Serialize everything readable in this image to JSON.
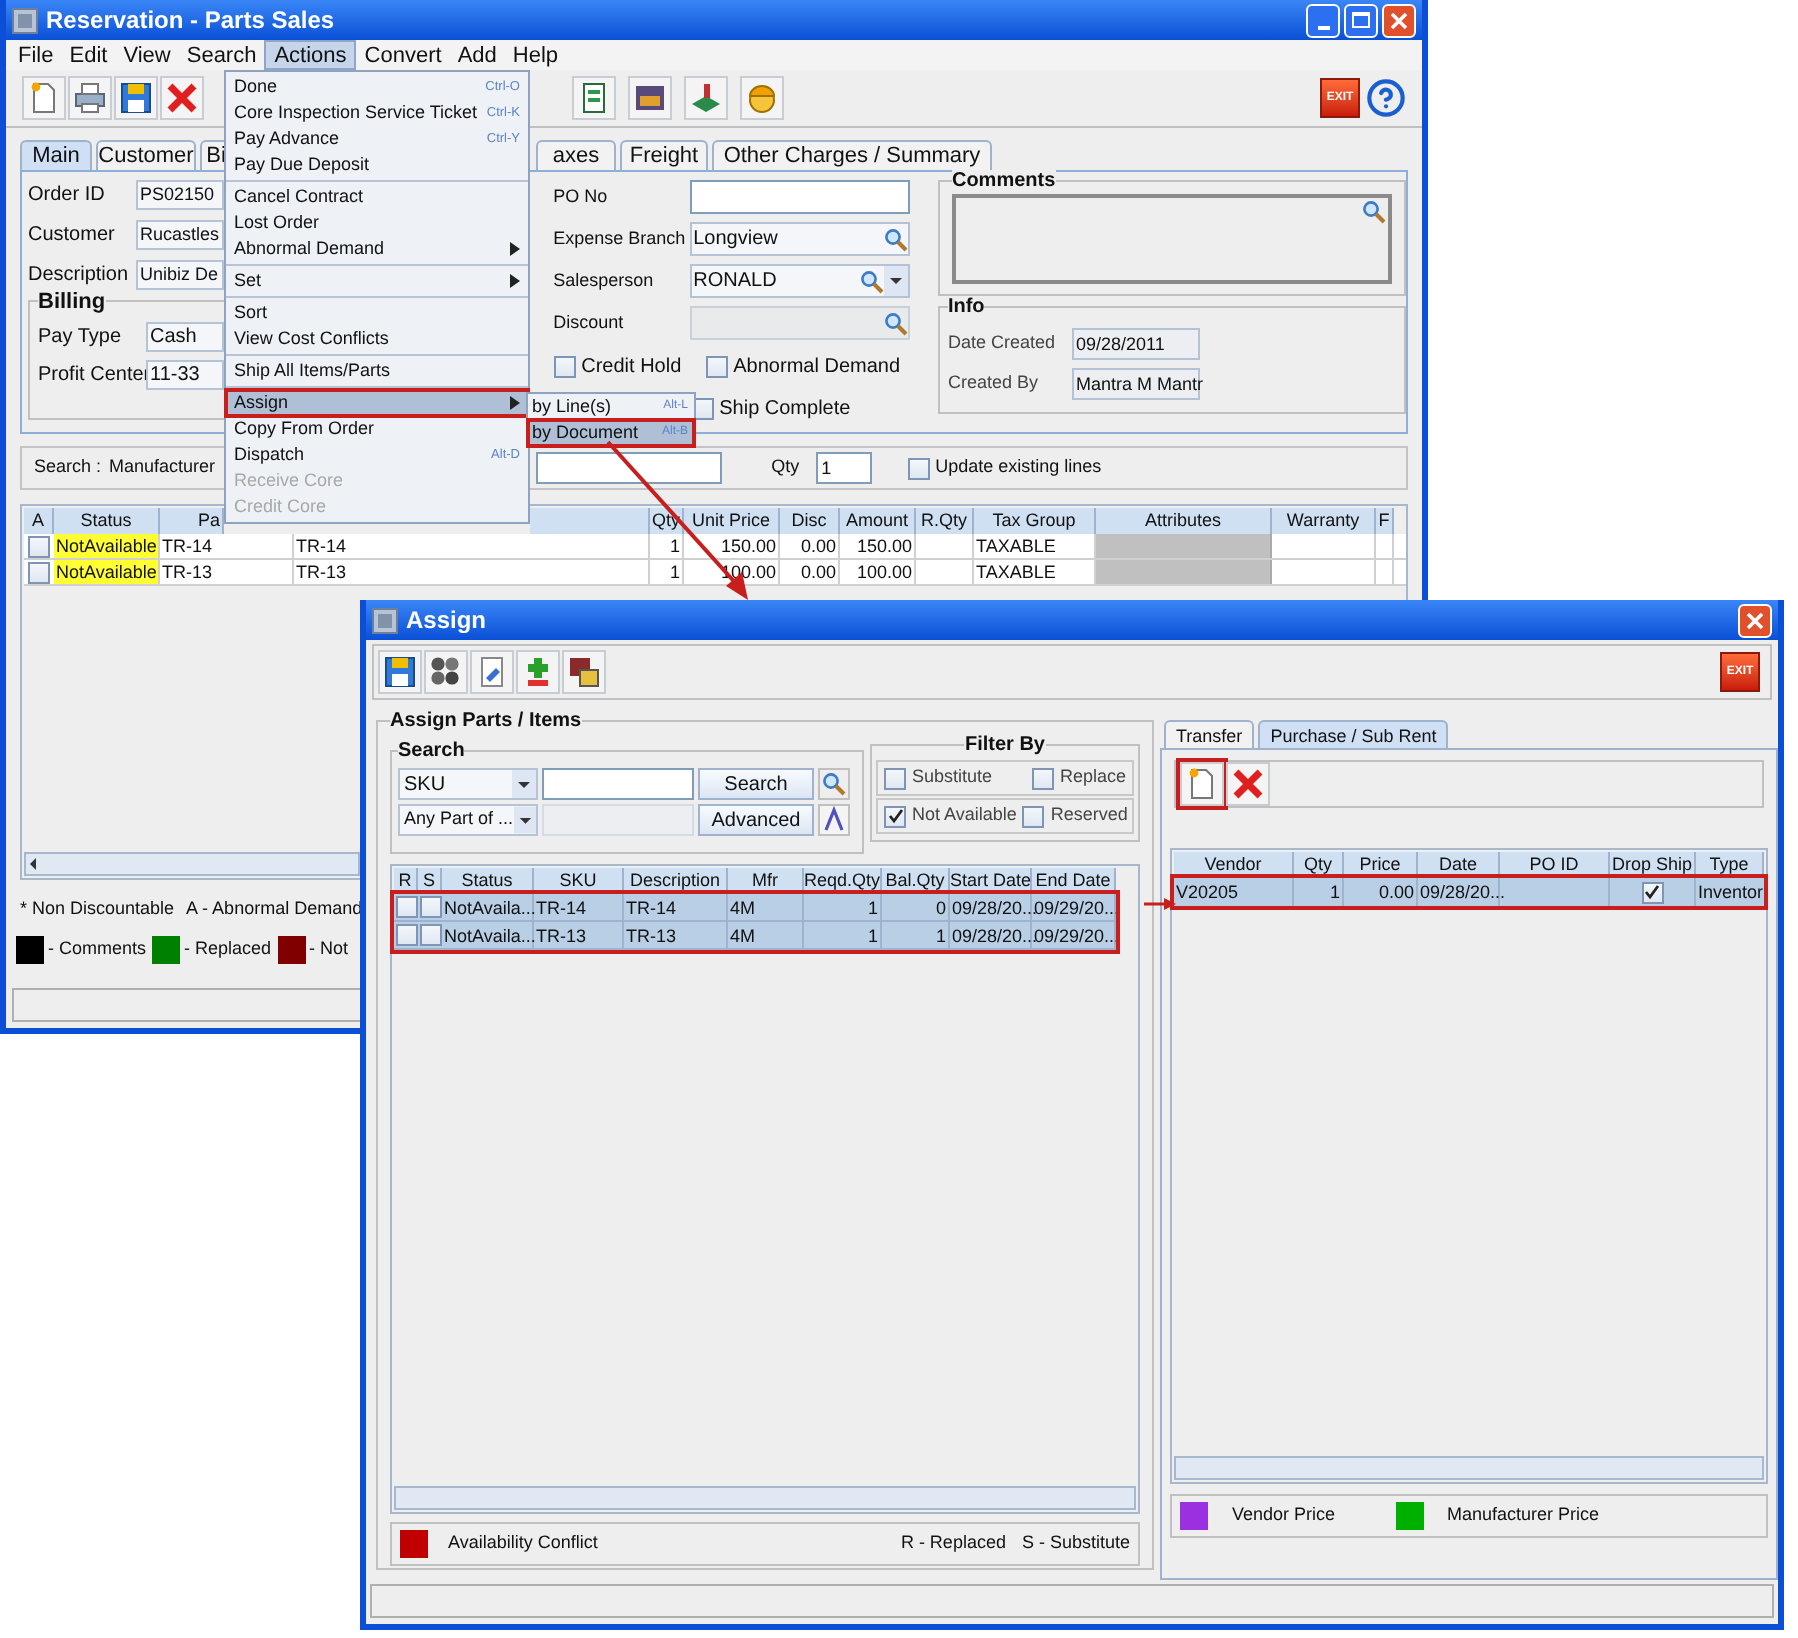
{
  "main_window": {
    "title": "Reservation - Parts Sales",
    "menu_bar": [
      {
        "label": "File",
        "selected": false
      },
      {
        "label": "Edit",
        "selected": false
      },
      {
        "label": "View",
        "selected": false
      },
      {
        "label": "Search",
        "selected": false
      },
      {
        "label": "Actions",
        "selected": true
      },
      {
        "label": "Convert",
        "selected": false
      },
      {
        "label": "Add",
        "selected": false
      },
      {
        "label": "Help",
        "selected": false
      }
    ],
    "exit_label": "EXIT",
    "tabs": [
      {
        "label": "Main",
        "selected": true
      },
      {
        "label": "Customer",
        "selected": false
      },
      {
        "label": "Bi",
        "selected": false
      },
      {
        "label": "axes",
        "selected": false
      },
      {
        "label": "Freight",
        "selected": false
      },
      {
        "label": "Other Charges / Summary",
        "selected": false
      }
    ],
    "left_fields": [
      {
        "label": "Order ID",
        "value": "PS02150"
      },
      {
        "label": "Customer",
        "value": "Rucastles"
      },
      {
        "label": "Description",
        "value": "Unibiz De"
      }
    ],
    "billing": {
      "title": "Billing",
      "fields": [
        {
          "label": "Pay Type",
          "value": "Cash"
        },
        {
          "label": "Profit Center",
          "value": "11-33"
        }
      ]
    },
    "middle_fields": [
      {
        "label": "PO No",
        "kind": "text"
      },
      {
        "label": "Expense Branch",
        "kind": "lookup",
        "value": "Longview"
      },
      {
        "label": "Salesperson",
        "kind": "lookup_dropdown",
        "value": "RONALD"
      },
      {
        "label": "Discount",
        "kind": "lookup_disabled"
      }
    ],
    "checkboxes": [
      {
        "label": "Credit Hold",
        "checked": false
      },
      {
        "label": "Abnormal Demand",
        "checked": false
      },
      {
        "label": "Ship Complete",
        "checked": false
      }
    ],
    "comments": {
      "title": "Comments"
    },
    "info": {
      "title": "Info",
      "fields": [
        {
          "label": "Date Created",
          "value": "09/28/2011"
        },
        {
          "label": "Created By",
          "value": "Mantra M Mantr"
        }
      ]
    },
    "search_bar": {
      "label": "Search :",
      "field_label": "Manufacturer",
      "qty_label": "Qty",
      "qty": "1",
      "update": {
        "label": "Update existing lines",
        "checked": false
      }
    },
    "table": {
      "columns": [
        "A",
        "Status",
        "Pa",
        "Qty",
        "Unit Price",
        "Disc",
        "Amount",
        "R.Qty",
        "Tax Group",
        "Attributes",
        "Warranty",
        "F"
      ],
      "rows": [
        {
          "checked": false,
          "available": false,
          "status": "NotAvailable",
          "part": "TR-14",
          "description": "TR-14",
          "qty": "1",
          "unit_price": "150.00",
          "disc": "0.00",
          "amount": "150.00",
          "tax_group": "TAXABLE"
        },
        {
          "checked": false,
          "available": false,
          "status": "NotAvailable",
          "part": "TR-13",
          "description": "TR-13",
          "qty": "1",
          "unit_price": "100.00",
          "disc": "0.00",
          "amount": "100.00",
          "tax_group": "TAXABLE"
        }
      ]
    },
    "legend": {
      "notes": [
        "* Non Discountable",
        "A - Abnormal Demand"
      ],
      "items": [
        {
          "label": "- Comments",
          "color": "#000000"
        },
        {
          "label": "- Replaced",
          "color": "#008000"
        },
        {
          "label": "- Not",
          "color": "#800000"
        }
      ]
    }
  },
  "actions_menu": [
    {
      "kind": "item",
      "label": "Done",
      "shortcut": "Ctrl-O"
    },
    {
      "kind": "item",
      "label": "Core Inspection Service Ticket",
      "shortcut": "Ctrl-K"
    },
    {
      "kind": "item",
      "label": "Pay Advance",
      "shortcut": "Ctrl-Y"
    },
    {
      "kind": "item",
      "label": "Pay Due Deposit"
    },
    {
      "kind": "separator"
    },
    {
      "kind": "item",
      "label": "Cancel Contract"
    },
    {
      "kind": "item",
      "label": "Lost Order"
    },
    {
      "kind": "submenu",
      "label": "Abnormal Demand",
      "selected": false
    },
    {
      "kind": "separator"
    },
    {
      "kind": "submenu",
      "label": "Set",
      "selected": false
    },
    {
      "kind": "separator"
    },
    {
      "kind": "item",
      "label": "Sort"
    },
    {
      "kind": "item",
      "label": "View Cost Conflicts"
    },
    {
      "kind": "separator"
    },
    {
      "kind": "item",
      "label": "Ship All Items/Parts"
    },
    {
      "kind": "separator"
    },
    {
      "kind": "submenu",
      "label": "Assign",
      "selected": true
    },
    {
      "kind": "item",
      "label": "Copy From Order"
    },
    {
      "kind": "item",
      "label": "Dispatch",
      "shortcut": "Alt-D"
    },
    {
      "kind": "disabled",
      "label": "Receive Core"
    },
    {
      "kind": "disabled",
      "label": "Credit Core"
    }
  ],
  "assign_submenu": [
    {
      "label": "by Line(s)",
      "shortcut": "Alt-L",
      "selected": false
    },
    {
      "label": "by Document",
      "shortcut": "Alt-B",
      "selected": true
    }
  ],
  "assign_dialog": {
    "title": "Assign",
    "exit_label": "EXIT",
    "panel_title": "Assign Parts / Items",
    "search": {
      "title": "Search",
      "field_type": "SKU",
      "match": "Any Part of ...",
      "search_button": "Search",
      "advanced_button": "Advanced"
    },
    "filter": {
      "title": "Filter By",
      "options": [
        {
          "label": "Substitute",
          "checked": false
        },
        {
          "label": "Replace",
          "checked": false
        },
        {
          "label": "Not Available",
          "checked": true
        },
        {
          "label": "Reserved",
          "checked": false
        }
      ]
    },
    "table": {
      "outlined": true,
      "columns": [
        "R",
        "S",
        "Status",
        "SKU",
        "Description",
        "Mfr",
        "Reqd.Qty",
        "Bal.Qty",
        "Start Date",
        "End Date"
      ],
      "rows": [
        {
          "replaced": false,
          "substitute": false,
          "selected": true,
          "status": "NotAvaila...",
          "sku": "TR-14",
          "description": "TR-14",
          "mfr": "4M",
          "reqd_qty": "1",
          "bal_qty": "0",
          "start_date": "09/28/20...",
          "end_date": "09/29/20..."
        },
        {
          "replaced": false,
          "substitute": false,
          "selected": true,
          "status": "NotAvaila...",
          "sku": "TR-13",
          "description": "TR-13",
          "mfr": "4M",
          "reqd_qty": "1",
          "bal_qty": "1",
          "start_date": "09/28/20...",
          "end_date": "09/29/20..."
        }
      ]
    },
    "legend": [
      {
        "label": "Availability Conflict",
        "color": "#c00000"
      }
    ],
    "legend_notes": [
      "R - Replaced",
      "S - Substitute"
    ],
    "right_tabs": [
      {
        "label": "Transfer",
        "selected": false
      },
      {
        "label": "Purchase / Sub Rent",
        "selected": true
      }
    ],
    "new_button_outlined": true,
    "vendor_table": {
      "outlined": true,
      "columns": [
        "Vendor",
        "Qty",
        "Price",
        "Date",
        "PO ID",
        "Drop Ship",
        "Type"
      ],
      "rows": [
        {
          "selected": true,
          "vendor": "V20205",
          "qty": "1",
          "price": "0.00",
          "date": "09/28/20...",
          "drop_ship": true,
          "type": "Inventor"
        }
      ]
    },
    "price_legend": [
      {
        "label": "Vendor Price",
        "color": "#9b30e0"
      },
      {
        "label": "Manufacturer Price",
        "color": "#00b000"
      }
    ]
  }
}
